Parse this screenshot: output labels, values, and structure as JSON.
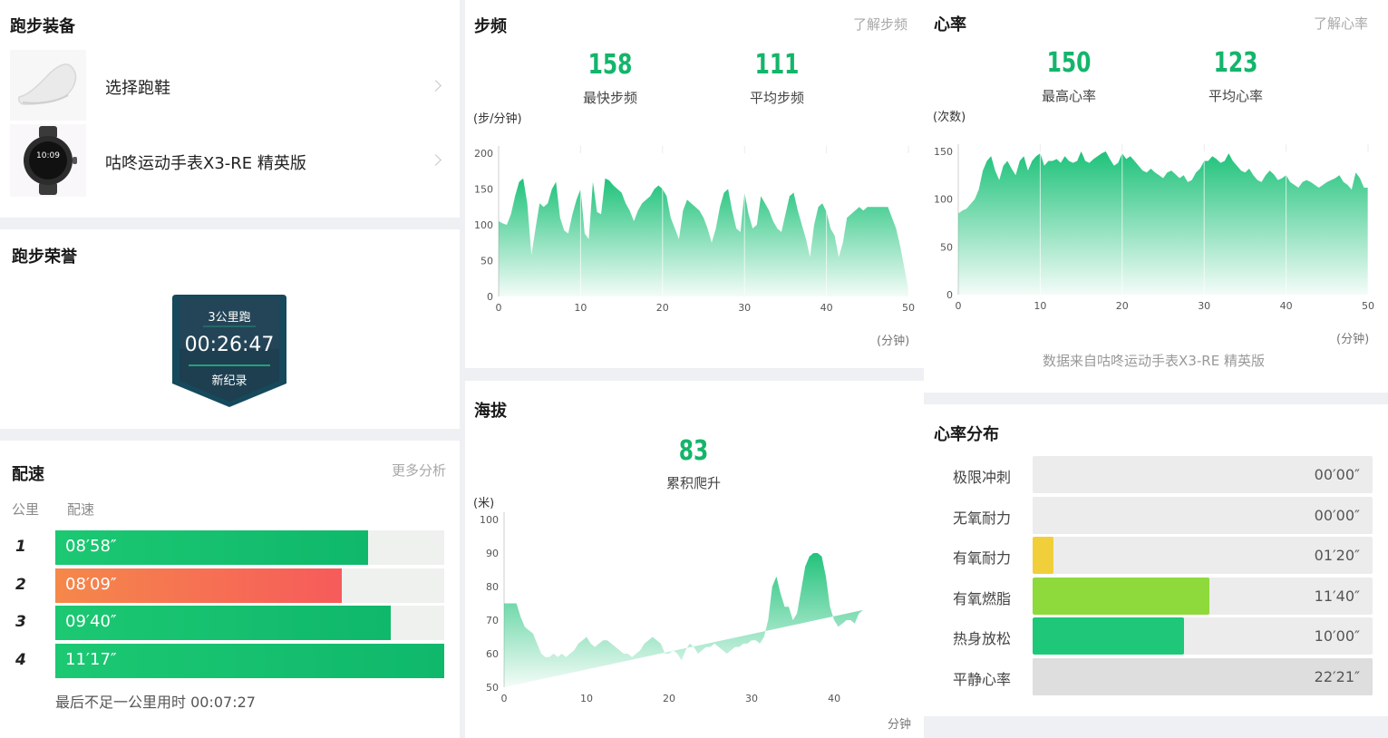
{
  "gear": {
    "title": "跑步装备",
    "items": [
      {
        "label": "选择跑鞋",
        "icon": "shoe-icon"
      },
      {
        "label": "咕咚运动手表X3-RE 精英版",
        "icon": "watch-icon",
        "watch_time": "10:09"
      }
    ]
  },
  "honor": {
    "title": "跑步荣誉",
    "badge": {
      "event": "3公里跑",
      "time": "00:26:47",
      "note": "新纪录"
    }
  },
  "pace": {
    "title": "配速",
    "more": "更多分析",
    "col_km": "公里",
    "col_pace": "配速",
    "rows": [
      {
        "km": "1",
        "pace": "08′58″",
        "fill": 0.805,
        "color": "green"
      },
      {
        "km": "2",
        "pace": "08′09″",
        "fill": 0.737,
        "color": "red"
      },
      {
        "km": "3",
        "pace": "09′40″",
        "fill": 0.862,
        "color": "green"
      },
      {
        "km": "4",
        "pace": "11′17″",
        "fill": 1.0,
        "color": "green"
      }
    ],
    "footer": "最后不足一公里用时 00:07:27"
  },
  "cadence": {
    "title": "步频",
    "link": "了解步频",
    "max_value": "158",
    "max_label": "最快步频",
    "avg_value": "111",
    "avg_label": "平均步频",
    "y_unit": "(步/分钟)",
    "x_unit": "(分钟)"
  },
  "altitude": {
    "title": "海拔",
    "climb_value": "83",
    "climb_label": "累积爬升",
    "y_unit": "(米)",
    "x_unit": "分钟"
  },
  "heart": {
    "title": "心率",
    "link": "了解心率",
    "max_value": "150",
    "max_label": "最高心率",
    "avg_value": "123",
    "avg_label": "平均心率",
    "y_unit": "(次数)",
    "x_unit": "(分钟)",
    "source": "数据来自咕咚运动手表X3-RE 精英版"
  },
  "hr_zones": {
    "title": "心率分布",
    "zones": [
      {
        "label": "极限冲刺",
        "time": "00′00″",
        "fill": 0.0,
        "color": "#e7e7e7"
      },
      {
        "label": "无氧耐力",
        "time": "00′00″",
        "fill": 0.0,
        "color": "#e7e7e7"
      },
      {
        "label": "有氧耐力",
        "time": "01′20″",
        "fill": 0.06,
        "color": "#f1cf3a"
      },
      {
        "label": "有氧燃脂",
        "time": "11′40″",
        "fill": 0.52,
        "color": "#8ed93c"
      },
      {
        "label": "热身放松",
        "time": "10′00″",
        "fill": 0.445,
        "color": "#1fc879"
      },
      {
        "label": "平静心率",
        "time": "22′21″",
        "fill": 1.0,
        "color": "#dedede"
      }
    ]
  },
  "chart_data": [
    {
      "type": "area",
      "ylabel": "(步/分钟)",
      "xlabel": "(分钟)",
      "xlim": [
        0,
        50
      ],
      "ylim": [
        0,
        200
      ],
      "x_ticks": [
        0,
        10,
        20,
        30,
        40,
        50
      ],
      "y_ticks": [
        0,
        50,
        100,
        150,
        200
      ],
      "x": [
        0,
        0.5,
        1,
        1.5,
        2,
        2.5,
        3,
        3.5,
        4,
        4.5,
        5,
        5.5,
        6,
        6.5,
        7,
        7.5,
        8,
        8.5,
        9,
        9.5,
        10,
        10.5,
        11,
        11.5,
        12,
        12.5,
        13,
        13.5,
        14,
        14.5,
        15,
        15.5,
        16,
        16.5,
        17,
        17.5,
        18,
        18.5,
        19,
        19.5,
        20,
        20.5,
        21,
        21.5,
        22,
        22.5,
        23,
        23.5,
        24,
        24.5,
        25,
        25.5,
        26,
        26.5,
        27,
        27.5,
        28,
        28.5,
        29,
        29.5,
        30,
        30.5,
        31,
        31.5,
        32,
        32.5,
        33,
        33.5,
        34,
        34.5,
        35,
        35.5,
        36,
        36.5,
        37,
        37.5,
        38,
        38.5,
        39,
        39.5,
        40,
        40.5,
        41,
        41.5,
        42,
        42.5,
        43,
        43.5,
        44,
        44.5,
        45,
        45.5,
        46,
        46.5,
        47,
        47.5,
        48,
        48.5,
        49,
        49.5,
        50
      ],
      "values": [
        105,
        102,
        100,
        115,
        140,
        160,
        165,
        130,
        58,
        95,
        130,
        125,
        130,
        150,
        160,
        110,
        92,
        88,
        115,
        135,
        150,
        88,
        80,
        160,
        118,
        115,
        165,
        162,
        155,
        150,
        145,
        130,
        120,
        105,
        120,
        130,
        135,
        140,
        150,
        155,
        150,
        140,
        110,
        95,
        80,
        120,
        135,
        130,
        125,
        120,
        110,
        95,
        75,
        95,
        125,
        145,
        150,
        120,
        95,
        90,
        145,
        115,
        95,
        100,
        140,
        130,
        120,
        105,
        95,
        90,
        115,
        140,
        145,
        120,
        100,
        80,
        55,
        100,
        125,
        130,
        118,
        95,
        85,
        55,
        75,
        110,
        115,
        120,
        125,
        120,
        125,
        125,
        125,
        125,
        125,
        125,
        110,
        95,
        70,
        40,
        10
      ],
      "series_color": "#1ec27a"
    },
    {
      "type": "area",
      "ylabel": "(米)",
      "xlabel": "分钟",
      "xlim": [
        0,
        49
      ],
      "ylim": [
        50,
        100
      ],
      "x_ticks": [
        0,
        10,
        20,
        30,
        40
      ],
      "y_ticks": [
        50,
        60,
        70,
        80,
        90,
        100
      ],
      "x": [
        0,
        0.5,
        1,
        1.5,
        2,
        2.5,
        3,
        3.5,
        4,
        4.5,
        5,
        5.5,
        6,
        6.5,
        7,
        7.5,
        8,
        8.5,
        9,
        9.5,
        10,
        10.5,
        11,
        11.5,
        12,
        12.5,
        13,
        13.5,
        14,
        14.5,
        15,
        15.5,
        16,
        16.5,
        17,
        17.5,
        18,
        18.5,
        19,
        19.5,
        20,
        20.5,
        21,
        21.5,
        22,
        22.5,
        23,
        23.5,
        24,
        24.5,
        25,
        25.5,
        26,
        26.5,
        27,
        27.5,
        28,
        28.5,
        29,
        29.5,
        30,
        30.5,
        31,
        31.5,
        32,
        32.5,
        33,
        33.5,
        34,
        34.5,
        35,
        35.5,
        36,
        36.5,
        37,
        37.5,
        38,
        38.5,
        39,
        39.5,
        40,
        40.5,
        41,
        41.5,
        42,
        42.5,
        43,
        43.5,
        44,
        44.5,
        45,
        45.5,
        46,
        46.5,
        47,
        47.5,
        48,
        48.5,
        49
      ],
      "values": [
        75,
        75,
        75,
        75,
        71,
        68,
        67,
        66,
        63,
        60,
        59,
        59,
        60,
        59,
        60,
        59,
        60,
        61,
        63,
        64,
        65,
        63,
        62,
        63,
        64,
        64,
        63,
        62,
        61,
        60,
        60,
        59,
        60,
        61,
        63,
        64,
        65,
        64,
        63,
        60,
        60,
        61,
        60,
        58,
        61,
        63,
        62,
        60,
        61,
        62,
        62,
        63,
        62,
        61,
        60,
        61,
        62,
        62,
        63,
        63,
        64,
        64,
        63,
        65,
        70,
        80,
        83,
        78,
        74,
        74,
        70,
        72,
        79,
        86,
        89,
        90,
        90,
        89,
        83,
        74,
        70,
        68,
        69,
        70,
        70,
        69,
        72,
        73
      ],
      "series_color": "#23c37c"
    },
    {
      "type": "area",
      "ylabel": "(次数)",
      "xlabel": "(分钟)",
      "xlim": [
        0,
        50
      ],
      "ylim": [
        0,
        150
      ],
      "x_ticks": [
        0,
        10,
        20,
        30,
        40,
        50
      ],
      "y_ticks": [
        0,
        50,
        100,
        150
      ],
      "x": [
        0,
        0.5,
        1,
        1.5,
        2,
        2.5,
        3,
        3.5,
        4,
        4.5,
        5,
        5.5,
        6,
        6.5,
        7,
        7.5,
        8,
        8.5,
        9,
        9.5,
        10,
        10.5,
        11,
        11.5,
        12,
        12.5,
        13,
        13.5,
        14,
        14.5,
        15,
        15.5,
        16,
        16.5,
        17,
        17.5,
        18,
        18.5,
        19,
        19.5,
        20,
        20.5,
        21,
        21.5,
        22,
        22.5,
        23,
        23.5,
        24,
        24.5,
        25,
        25.5,
        26,
        26.5,
        27,
        27.5,
        28,
        28.5,
        29,
        29.5,
        30,
        30.5,
        31,
        31.5,
        32,
        32.5,
        33,
        33.5,
        34,
        34.5,
        35,
        35.5,
        36,
        36.5,
        37,
        37.5,
        38,
        38.5,
        39,
        39.5,
        40,
        40.5,
        41,
        41.5,
        42,
        42.5,
        43,
        43.5,
        44,
        44.5,
        45,
        45.5,
        46,
        46.5,
        47,
        47.5,
        48,
        48.5,
        49,
        49.5,
        50
      ],
      "values": [
        85,
        88,
        90,
        95,
        100,
        110,
        130,
        140,
        145,
        130,
        120,
        135,
        140,
        132,
        125,
        140,
        145,
        130,
        140,
        145,
        148,
        135,
        140,
        140,
        142,
        138,
        145,
        140,
        138,
        140,
        150,
        140,
        138,
        142,
        145,
        148,
        150,
        142,
        135,
        138,
        148,
        142,
        145,
        140,
        135,
        130,
        128,
        132,
        128,
        125,
        122,
        128,
        130,
        126,
        122,
        125,
        118,
        120,
        128,
        132,
        140,
        140,
        145,
        142,
        138,
        140,
        148,
        140,
        135,
        130,
        128,
        132,
        125,
        120,
        118,
        125,
        130,
        126,
        120,
        122,
        125,
        118,
        115,
        112,
        118,
        120,
        118,
        115,
        112,
        115,
        118,
        120,
        122,
        125,
        118,
        115,
        110,
        128,
        122,
        112,
        112
      ],
      "series_color": "#1ec27a"
    }
  ]
}
